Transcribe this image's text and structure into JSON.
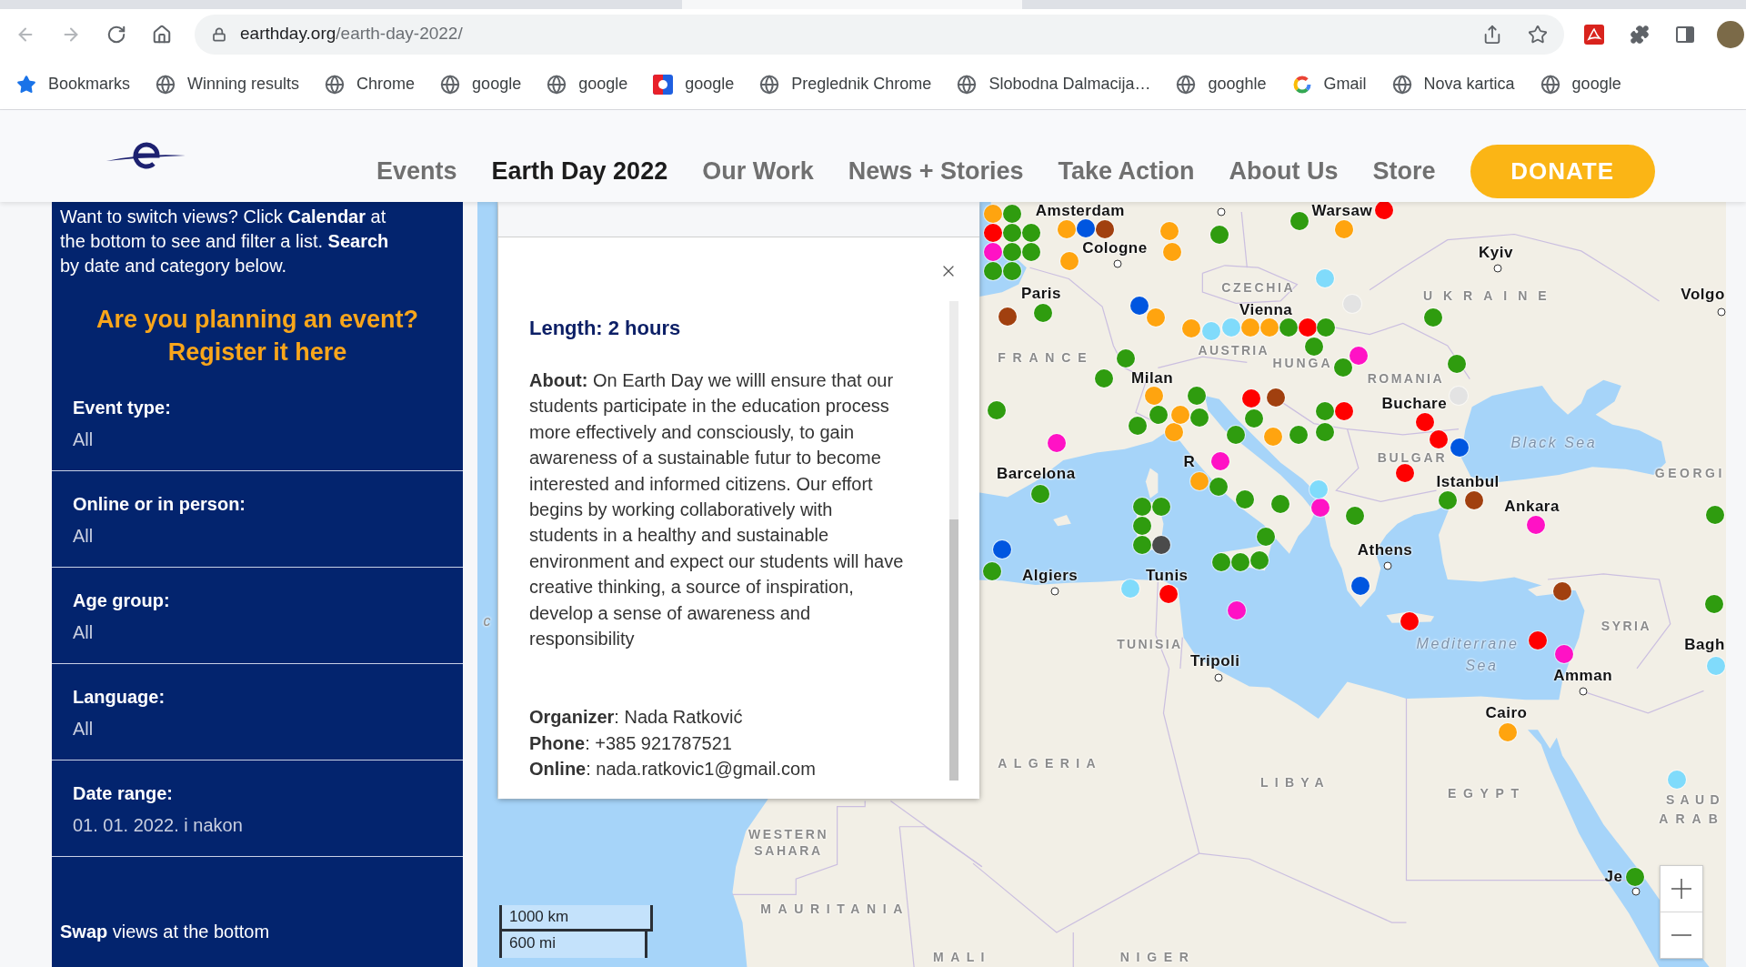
{
  "browser": {
    "nav_buttons": [
      {
        "kind": "back",
        "disabled": true
      },
      {
        "kind": "forward",
        "disabled": true
      },
      {
        "kind": "reload",
        "disabled": false
      },
      {
        "kind": "home",
        "disabled": false
      }
    ],
    "address": {
      "domain": "earthday.org",
      "path": "/earth-day-2022/"
    },
    "bookmarks": [
      {
        "kind": "star",
        "label": "Bookmarks"
      },
      {
        "kind": "globe",
        "label": "Winning results"
      },
      {
        "kind": "globe",
        "label": "Chrome"
      },
      {
        "kind": "globe",
        "label": "google"
      },
      {
        "kind": "globe",
        "label": "google"
      },
      {
        "kind": "dlogo",
        "label": "google"
      },
      {
        "kind": "globe",
        "label": "Preglednik Chrome"
      },
      {
        "kind": "globe",
        "label": "Slobodna Dalmacija…"
      },
      {
        "kind": "globe",
        "label": "googhle"
      },
      {
        "kind": "glogo",
        "label": "Gmail"
      },
      {
        "kind": "globe",
        "label": "Nova kartica"
      },
      {
        "kind": "globe",
        "label": "google"
      }
    ]
  },
  "site_header": {
    "nav": [
      {
        "label": "Events",
        "selected": false
      },
      {
        "label": "Earth Day 2022",
        "selected": true
      },
      {
        "label": "Our Work",
        "selected": false
      },
      {
        "label": "News + Stories",
        "selected": false
      },
      {
        "label": "Take Action",
        "selected": false
      },
      {
        "label": "About Us",
        "selected": false
      },
      {
        "label": "Store",
        "selected": false
      }
    ],
    "donate": "DONATE"
  },
  "sidebar": {
    "intro": "Want to switch views? Click **Calendar** at the bottom to see and filter a list. **Search** by date and category below.",
    "cta": [
      "Are you planning an event?",
      "Register it here"
    ],
    "filters": [
      {
        "label": "Event type:",
        "value": "All"
      },
      {
        "label": "Online or in person:",
        "value": "All"
      },
      {
        "label": "Age group:",
        "value": "All"
      },
      {
        "label": "Language:",
        "value": "All"
      },
      {
        "label": "Date range:",
        "value": "01. 01. 2022. i nakon"
      }
    ],
    "footer": "**Swap** views at the bottom"
  },
  "map": {
    "popup": {
      "length": "Length: 2 hours",
      "about": "**About:** On Earth Day we willl ensure that our students participate in the education process more effectively and consciously, to gain awareness of a sustainable futur to become interested and informed citizens. Our effort begins by working collaboratively with students in a healthy and sustainable environment and expect our students will have creative thinking, a source of inspiration, develop a sense of awareness and responsibility",
      "contacts": [
        "**Organizer**: Nada Ratković",
        "**Phone**: +385 921787521",
        "**Online**: nada.ratkovic1@gmail.com"
      ]
    },
    "labels": [
      {
        "kind": "city",
        "text": "Amsterdam",
        "dot": false
      },
      {
        "kind": "city",
        "text": "Warsaw",
        "dot": false
      },
      {
        "kind": "city",
        "text": "Cologne",
        "dot": true
      },
      {
        "kind": "city",
        "text": "Kyiv",
        "dot": true
      },
      {
        "kind": "city",
        "text": "Paris",
        "dot": false
      },
      {
        "kind": "country",
        "text": "CZECHIA"
      },
      {
        "kind": "country",
        "text": "UKRAINE"
      },
      {
        "kind": "city",
        "text": "Volgo",
        "dot": true
      },
      {
        "kind": "city",
        "text": "Vienna",
        "dot": false
      },
      {
        "kind": "country",
        "text": "FRANCE"
      },
      {
        "kind": "country",
        "text": "AUSTRIA"
      },
      {
        "kind": "country",
        "text": "HUNGA"
      },
      {
        "kind": "city",
        "text": "Milan",
        "dot": false
      },
      {
        "kind": "country",
        "text": "ROMANIA"
      },
      {
        "kind": "city",
        "text": "Buchare",
        "dot": false
      },
      {
        "kind": "sea",
        "text": "Black Sea"
      },
      {
        "kind": "city",
        "text": "R",
        "dot": false
      },
      {
        "kind": "country",
        "text": "BULGAR"
      },
      {
        "kind": "city",
        "text": "Barcelona",
        "dot": false
      },
      {
        "kind": "city",
        "text": "Istanbul",
        "dot": false
      },
      {
        "kind": "country",
        "text": "GEORGI"
      },
      {
        "kind": "city",
        "text": "Ankara",
        "dot": false
      },
      {
        "kind": "city",
        "text": "Athens",
        "dot": true
      },
      {
        "kind": "city",
        "text": "Algiers",
        "dot": true
      },
      {
        "kind": "city",
        "text": "Tunis",
        "dot": false
      },
      {
        "kind": "minor",
        "text": "c"
      },
      {
        "kind": "country",
        "text": "SYRIA"
      },
      {
        "kind": "country",
        "text": "TUNISIA"
      },
      {
        "kind": "sea",
        "text": "Mediterrane"
      },
      {
        "kind": "city",
        "text": "Bagh",
        "dot": false
      },
      {
        "kind": "city",
        "text": "Tripoli",
        "dot": true
      },
      {
        "kind": "sea",
        "text": "Sea"
      },
      {
        "kind": "city",
        "text": "Amman",
        "dot": true
      },
      {
        "kind": "city",
        "text": "Cairo",
        "dot": false
      },
      {
        "kind": "country",
        "text": "ALGERIA"
      },
      {
        "kind": "country",
        "text": "LIBYA"
      },
      {
        "kind": "country",
        "text": "EGYPT"
      },
      {
        "kind": "country",
        "text": "SAUD"
      },
      {
        "kind": "country",
        "text": "ARAB"
      },
      {
        "kind": "country",
        "text": "WESTERN SAHARA"
      },
      {
        "kind": "city",
        "text": "Je",
        "dot": true
      },
      {
        "kind": "country",
        "text": "MAURITANIA"
      },
      {
        "kind": "country",
        "text": "MALI"
      },
      {
        "kind": "country",
        "text": "NIGER"
      }
    ],
    "markers": [
      {
        "color": "#ffa40f"
      },
      {
        "color": "#ff0000"
      },
      {
        "color": "#ff12c5"
      },
      {
        "color": "#2f9c0f"
      },
      {
        "color": "#2f9c0f"
      },
      {
        "color": "#2f9c0f"
      },
      {
        "color": "#2f9c0f"
      },
      {
        "color": "#2f9c0f"
      },
      {
        "color": "#2f9c0f"
      },
      {
        "color": "#2f9c0f"
      },
      {
        "color": "#0056e0"
      },
      {
        "color": "#a1400f"
      },
      {
        "color": "#ffa40f"
      },
      {
        "color": "#ffa40f"
      },
      {
        "color": "#ffa40f"
      },
      {
        "color": "#ffa40f"
      },
      {
        "color": "#2f9c0f"
      },
      {
        "color": "#2f9c0f"
      },
      {
        "color": "#ffa40f"
      },
      {
        "color": "#ff0000"
      },
      {
        "color": "#80dbfb"
      },
      {
        "color": "#e3e3e3"
      },
      {
        "color": "#a1400f"
      },
      {
        "color": "#2f9c0f"
      },
      {
        "color": "#0056e0"
      },
      {
        "color": "#ffa40f"
      },
      {
        "color": "#ffa40f"
      },
      {
        "color": "#80dbfb"
      },
      {
        "color": "#80dbfb"
      },
      {
        "color": "#ffa40f"
      },
      {
        "color": "#ffa40f"
      },
      {
        "color": "#2f9c0f"
      },
      {
        "color": "#ff0000"
      },
      {
        "color": "#2f9c0f"
      },
      {
        "color": "#2f9c0f"
      },
      {
        "color": "#ff12c5"
      },
      {
        "color": "#2f9c0f"
      },
      {
        "color": "#2f9c0f"
      },
      {
        "color": "#2f9c0f"
      },
      {
        "color": "#2f9c0f"
      },
      {
        "color": "#2f9c0f"
      },
      {
        "color": "#2f9c0f"
      },
      {
        "color": "#ffa40f"
      },
      {
        "color": "#2f9c0f"
      },
      {
        "color": "#2f9c0f"
      },
      {
        "color": "#2f9c0f"
      },
      {
        "color": "#ffa40f"
      },
      {
        "color": "#ffa40f"
      },
      {
        "color": "#2f9c0f"
      },
      {
        "color": "#ff0000"
      },
      {
        "color": "#a1400f"
      },
      {
        "color": "#2f9c0f"
      },
      {
        "color": "#2f9c0f"
      },
      {
        "color": "#ffa40f"
      },
      {
        "color": "#2f9c0f"
      },
      {
        "color": "#2f9c0f"
      },
      {
        "color": "#ff0000"
      },
      {
        "color": "#2f9c0f"
      },
      {
        "color": "#e3e3e3"
      },
      {
        "color": "#ff0000"
      },
      {
        "color": "#ff0000"
      },
      {
        "color": "#0056e0"
      },
      {
        "color": "#ff12c5"
      },
      {
        "color": "#ff12c5"
      },
      {
        "color": "#ffa40f"
      },
      {
        "color": "#2f9c0f"
      },
      {
        "color": "#2f9c0f"
      },
      {
        "color": "#ff0000"
      },
      {
        "color": "#ff12c5"
      },
      {
        "color": "#80dbfb"
      },
      {
        "color": "#2f9c0f"
      },
      {
        "color": "#2f9c0f"
      },
      {
        "color": "#2f9c0f"
      },
      {
        "color": "#2f9c0f"
      },
      {
        "color": "#a1400f"
      },
      {
        "color": "#ff12c5"
      },
      {
        "color": "#2f9c0f"
      },
      {
        "color": "#2f9c0f"
      },
      {
        "color": "#2f9c0f"
      },
      {
        "color": "#2f9c0f"
      },
      {
        "color": "#4b4b4b"
      },
      {
        "color": "#2f9c0f"
      },
      {
        "color": "#0056e0"
      },
      {
        "color": "#2f9c0f"
      },
      {
        "color": "#2f9c0f"
      },
      {
        "color": "#2f9c0f"
      },
      {
        "color": "#2f9c0f"
      },
      {
        "color": "#80dbfb"
      },
      {
        "color": "#ff0000"
      },
      {
        "color": "#0056e0"
      },
      {
        "color": "#a1400f"
      },
      {
        "color": "#ff12c5"
      },
      {
        "color": "#2f9c0f"
      },
      {
        "color": "#2f9c0f"
      },
      {
        "color": "#ff0000"
      },
      {
        "color": "#ff0000"
      },
      {
        "color": "#ff12c5"
      },
      {
        "color": "#80dbfb"
      },
      {
        "color": "#ffa40f"
      },
      {
        "color": "#80dbfb"
      },
      {
        "color": "#2f9c0f"
      }
    ],
    "scale": [
      "1000 km",
      "600 mi"
    ]
  }
}
